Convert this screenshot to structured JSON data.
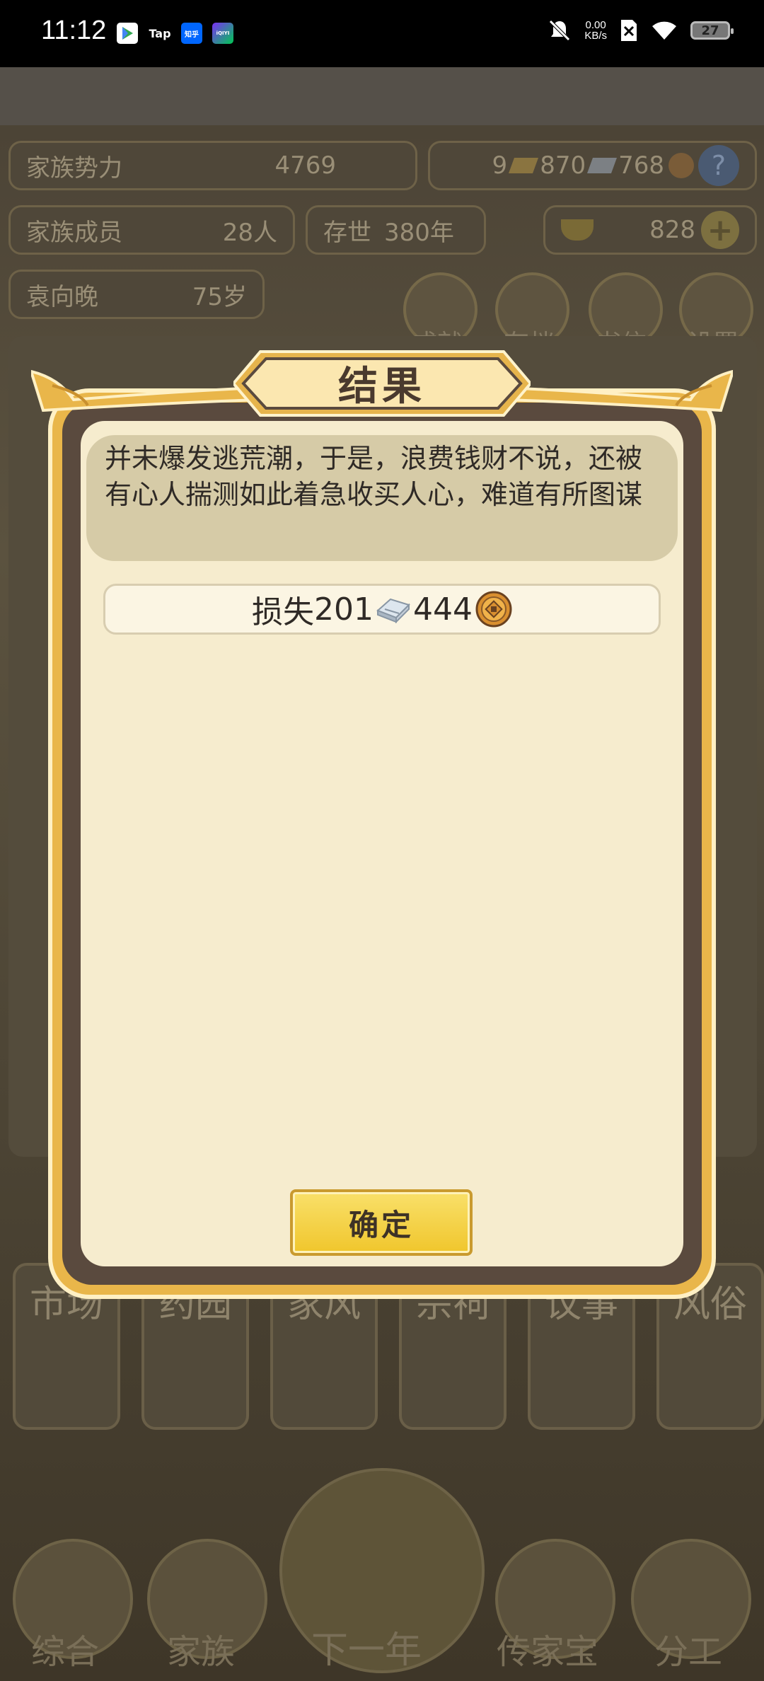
{
  "status_bar": {
    "time": "11:12",
    "apps": [
      "Tap",
      "知乎",
      "iQIYI"
    ],
    "net_speed_value": "0.00",
    "net_speed_unit": "KB/s",
    "battery": "27"
  },
  "stats": {
    "family_power_label": "家族势力",
    "family_power_value": "4769",
    "gold_count": "9",
    "silver_count": "870",
    "coin_count": "768",
    "members_label": "家族成员",
    "members_value": "28人",
    "survival_label": "存世",
    "survival_value": "380年",
    "ingot_count": "828",
    "person_name": "袁向晚",
    "person_age": "75岁"
  },
  "top_menu": [
    {
      "label": "成就",
      "icon": "achievement-icon"
    },
    {
      "label": "存档",
      "icon": "save-icon"
    },
    {
      "label": "书信",
      "icon": "letter-icon"
    },
    {
      "label": "设置",
      "icon": "settings-icon"
    }
  ],
  "side_cards": [
    "市场",
    "药园",
    "家风",
    "宗祠",
    "议事",
    "风俗"
  ],
  "bottom_nav": [
    {
      "label": "综合",
      "icon": "scroll-icon"
    },
    {
      "label": "家族",
      "icon": "house-icon"
    },
    {
      "label": "下一年",
      "icon": "mountain-icon"
    },
    {
      "label": "传家宝",
      "icon": "jade-icon"
    },
    {
      "label": "分工",
      "icon": "people-icon"
    }
  ],
  "dialog": {
    "title": "结果",
    "description": "并未爆发逃荒潮，于是，浪费钱财不说，还被有心人揣测如此着急收买人心，难道有所图谋",
    "loss_prefix": "损失",
    "loss_silver": "201",
    "loss_coin": "444",
    "confirm_label": "确定"
  },
  "colors": {
    "dialog_gold": "#e9b64a",
    "dialog_bg": "#f6ecce",
    "button_yellow": "#f0c62c",
    "text_dark": "#2f2a26"
  }
}
